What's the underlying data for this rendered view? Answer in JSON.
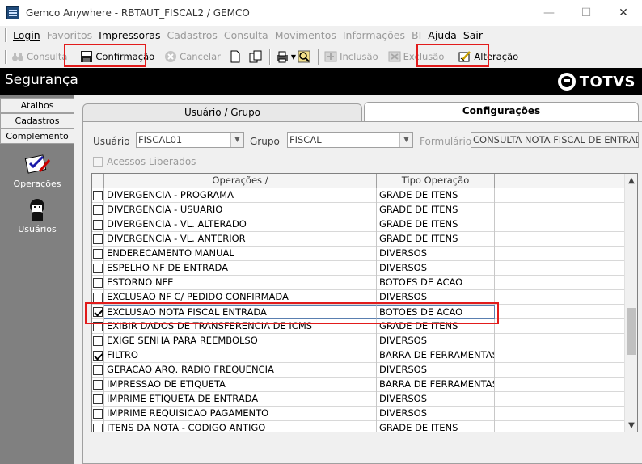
{
  "window": {
    "title": "Gemco Anywhere - RBTAUT_FISCAL2 / GEMCO",
    "minimize_label": "—",
    "maximize_label": "☐",
    "close_label": "✕"
  },
  "menubar": {
    "items": [
      {
        "label": "Login",
        "enabled": true
      },
      {
        "label": "Favoritos",
        "enabled": false
      },
      {
        "label": "Impressoras",
        "enabled": true
      },
      {
        "label": "Cadastros",
        "enabled": false
      },
      {
        "label": "Consulta",
        "enabled": false
      },
      {
        "label": "Movimentos",
        "enabled": false
      },
      {
        "label": "Informações",
        "enabled": false
      },
      {
        "label": "BI",
        "enabled": false
      },
      {
        "label": "Ajuda",
        "enabled": true
      },
      {
        "label": "Sair",
        "enabled": true
      }
    ]
  },
  "toolbar": {
    "consulta_label": "Consulta",
    "confirmacao_label": "Confirmação",
    "cancelar_label": "Cancelar",
    "inclusao_label": "Inclusão",
    "exclusao_label": "Exclusão",
    "alteracao_label": "Alteração"
  },
  "header": {
    "title": "Segurança",
    "brand": "TOTVS"
  },
  "sidebar": {
    "tabs": [
      "Atalhos",
      "Cadastros",
      "Complemento"
    ],
    "items": [
      {
        "label": "Operações",
        "icon": "operations-icon"
      },
      {
        "label": "Usuários",
        "icon": "users-icon"
      }
    ]
  },
  "tabs": {
    "usuario_grupo": "Usuário  / Grupo",
    "configuracoes": "Configurações"
  },
  "form": {
    "usuario_label": "Usuário",
    "usuario_value": "FISCAL01",
    "grupo_label": "Grupo",
    "grupo_value": "FISCAL",
    "formulario_label": "Formulário",
    "formulario_value": "CONSULTA NOTA FISCAL DE ENTRADA",
    "acessos_label": "Acessos Liberados"
  },
  "grid": {
    "col_operacoes": "Operações  /",
    "col_tipo": "Tipo Operação",
    "rows": [
      {
        "op": "DIVERGENCIA - PROGRAMA",
        "tipo": "GRADE DE ITENS",
        "checked": false
      },
      {
        "op": "DIVERGENCIA - USUARIO",
        "tipo": "GRADE DE ITENS",
        "checked": false
      },
      {
        "op": "DIVERGENCIA - VL. ALTERADO",
        "tipo": "GRADE DE ITENS",
        "checked": false
      },
      {
        "op": "DIVERGENCIA - VL. ANTERIOR",
        "tipo": "GRADE DE ITENS",
        "checked": false
      },
      {
        "op": "ENDERECAMENTO MANUAL",
        "tipo": "DIVERSOS",
        "checked": false
      },
      {
        "op": "ESPELHO NF DE ENTRADA",
        "tipo": "DIVERSOS",
        "checked": false
      },
      {
        "op": "ESTORNO NFE",
        "tipo": "BOTOES DE ACAO",
        "checked": false
      },
      {
        "op": "EXCLUSAO NF C/ PEDIDO CONFIRMADA",
        "tipo": "DIVERSOS",
        "checked": false
      },
      {
        "op": "EXCLUSAO NOTA FISCAL ENTRADA",
        "tipo": "BOTOES DE ACAO",
        "checked": true,
        "selected": true
      },
      {
        "op": "EXIBIR DADOS DE TRANSFERENCIA DE ICMS",
        "tipo": "GRADE DE ITENS",
        "checked": false
      },
      {
        "op": "EXIGE SENHA PARA REEMBOLSO",
        "tipo": "DIVERSOS",
        "checked": false
      },
      {
        "op": "FILTRO",
        "tipo": "BARRA DE FERRAMENTAS",
        "checked": true
      },
      {
        "op": "GERACAO ARQ. RADIO FREQUENCIA",
        "tipo": "DIVERSOS",
        "checked": false
      },
      {
        "op": "IMPRESSAO DE ETIQUETA",
        "tipo": "BARRA DE FERRAMENTAS",
        "checked": false
      },
      {
        "op": "IMPRIME ETIQUETA DE ENTRADA",
        "tipo": "DIVERSOS",
        "checked": false
      },
      {
        "op": "IMPRIME REQUISICAO PAGAMENTO",
        "tipo": "DIVERSOS",
        "checked": false
      },
      {
        "op": "ITENS DA NOTA - CODIGO ANTIGO",
        "tipo": "GRADE DE ITENS",
        "checked": false
      }
    ]
  },
  "colors": {
    "highlight": "#e21b1b",
    "header_bg": "#000000",
    "sidebar_bg": "#808080"
  }
}
